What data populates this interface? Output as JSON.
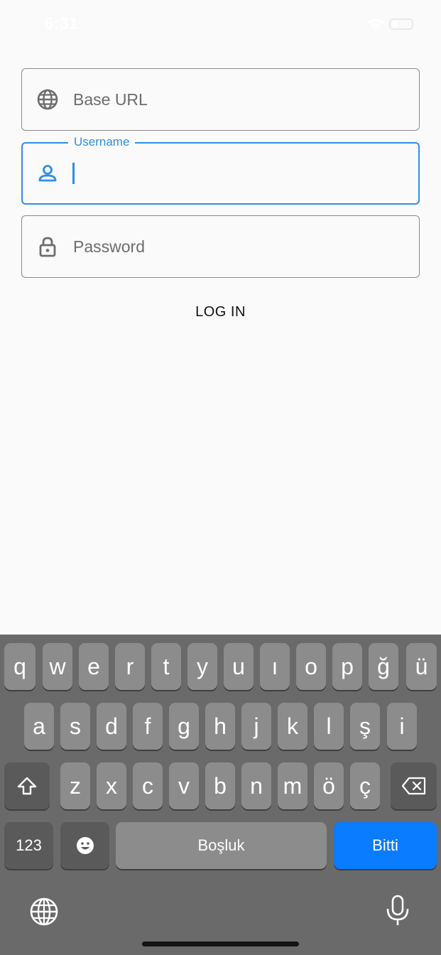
{
  "status_bar": {
    "time": "6:31"
  },
  "form": {
    "base_url": {
      "placeholder": "Base URL",
      "icon": "globe-icon"
    },
    "username": {
      "label": "Username",
      "value": "",
      "icon": "person-icon"
    },
    "password": {
      "placeholder": "Password",
      "icon": "lock-icon"
    },
    "login_label": "LOG IN",
    "accent_color": "#2e8ee8"
  },
  "keyboard": {
    "row1": [
      "q",
      "w",
      "e",
      "r",
      "t",
      "y",
      "u",
      "ı",
      "o",
      "p",
      "ğ",
      "ü"
    ],
    "row2": [
      "a",
      "s",
      "d",
      "f",
      "g",
      "h",
      "j",
      "k",
      "l",
      "ş",
      "i"
    ],
    "row3": [
      "z",
      "x",
      "c",
      "v",
      "b",
      "n",
      "m",
      "ö",
      "ç"
    ],
    "numbers_label": "123",
    "space_label": "Boşluk",
    "done_label": "Bitti",
    "done_color": "#0a7cff"
  }
}
